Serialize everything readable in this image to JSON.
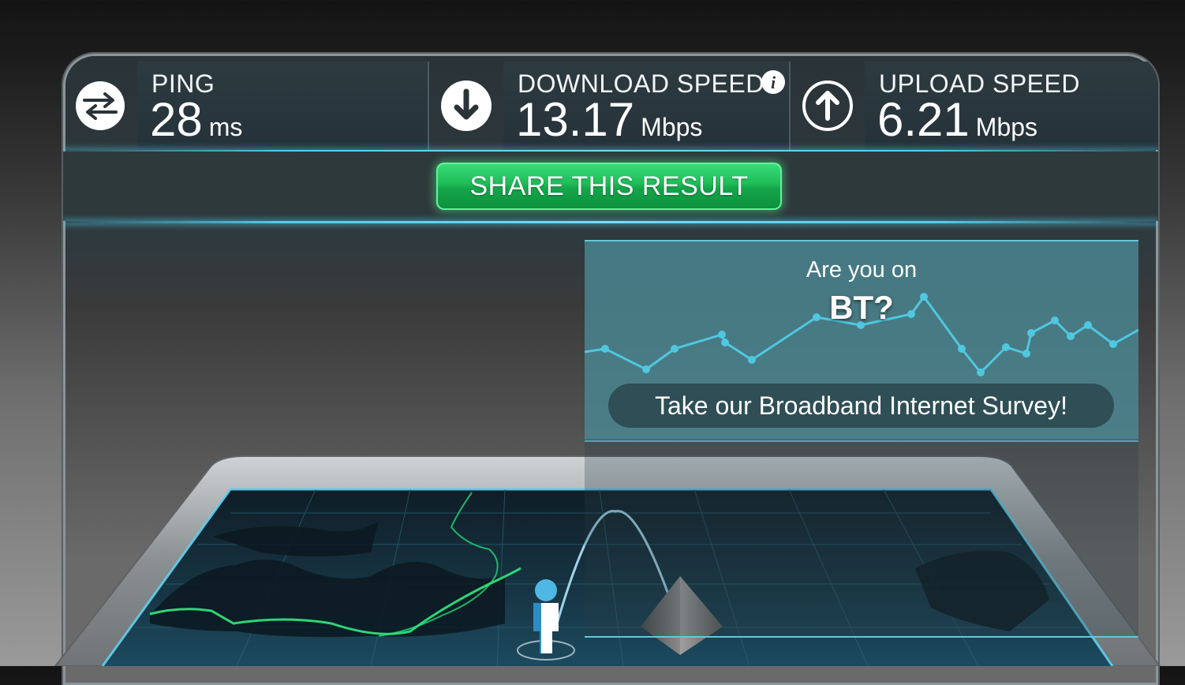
{
  "stats": {
    "ping": {
      "label": "PING",
      "value": "28",
      "unit": "ms"
    },
    "download": {
      "label": "DOWNLOAD SPEED",
      "value": "13.17",
      "unit": "Mbps"
    },
    "upload": {
      "label": "UPLOAD SPEED",
      "value": "6.21",
      "unit": "Mbps"
    }
  },
  "share": {
    "label": "SHARE THIS RESULT"
  },
  "ad": {
    "line1": "Are you on",
    "line2": "BT?",
    "survey_label": "Take our Broadband Internet Survey!"
  },
  "colors": {
    "accent_cyan": "#58c9ea",
    "share_green": "#1fbb58",
    "ad_panel": "#4a8894",
    "route_green": "#2ee07a"
  },
  "icons": {
    "ping": "ping-arrows-icon",
    "download": "download-arrow-icon",
    "upload": "upload-arrow-icon",
    "info": "info-icon",
    "user": "user-figure-icon",
    "server": "server-pyramid-icon"
  }
}
